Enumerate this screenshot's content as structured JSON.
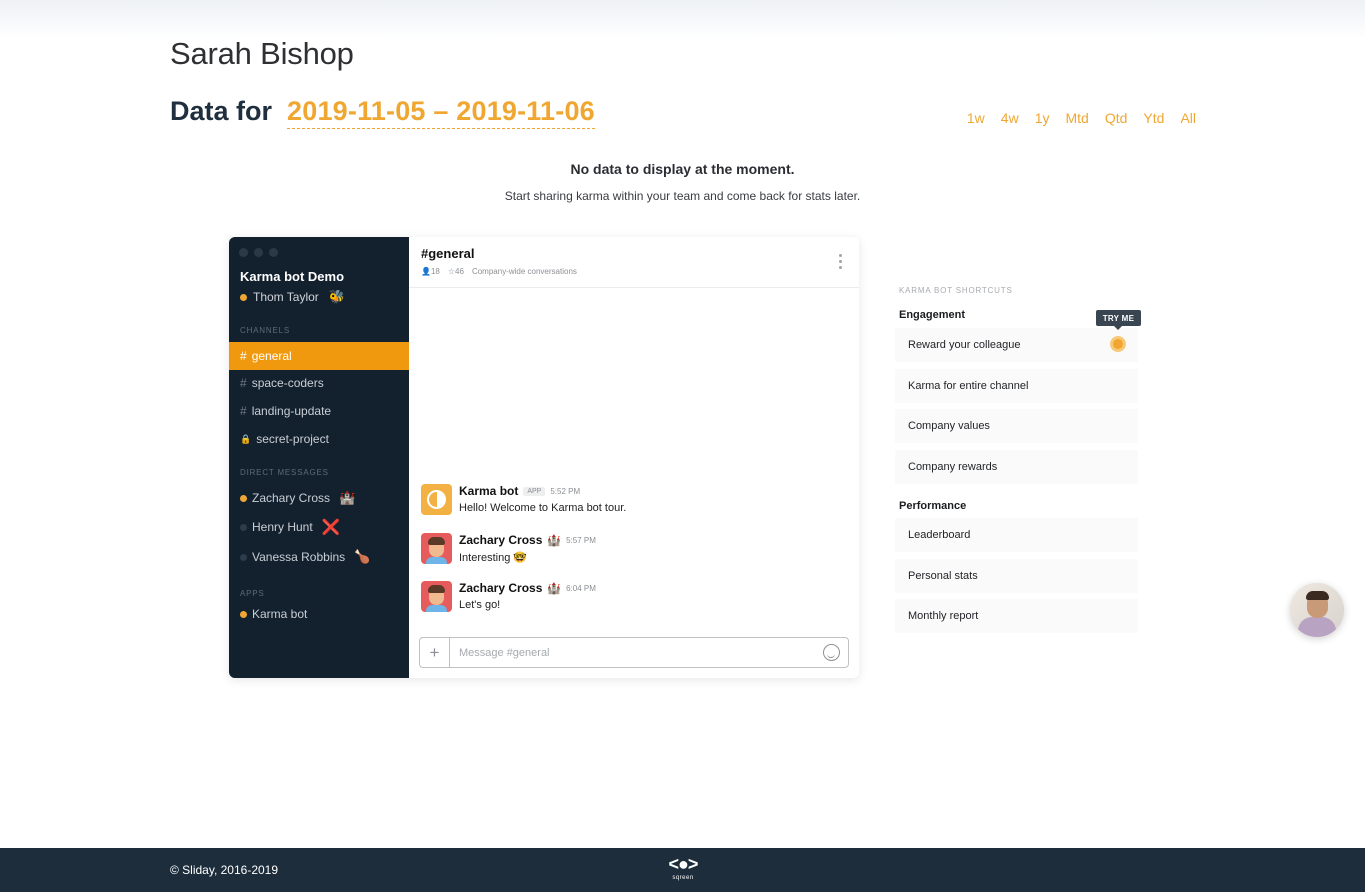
{
  "header": {
    "user_name": "Sarah Bishop",
    "data_for_label": "Data for",
    "date_range": "2019-11-05 – 2019-11-06",
    "periods": [
      "1w",
      "4w",
      "1y",
      "Mtd",
      "Qtd",
      "Ytd",
      "All"
    ]
  },
  "empty_state": {
    "title": "No data to display at the moment.",
    "subtitle": "Start sharing karma within your team and come back for stats later."
  },
  "demo": {
    "workspace": "Karma bot Demo",
    "current_user": "Thom Taylor",
    "current_user_emoji": "🐝",
    "channels_label": "CHANNELS",
    "channels": [
      {
        "name": "general",
        "prefix": "#"
      },
      {
        "name": "space-coders",
        "prefix": "#"
      },
      {
        "name": "landing-update",
        "prefix": "#"
      },
      {
        "name": "secret-project",
        "prefix": "🔒"
      }
    ],
    "dm_label": "DIRECT MESSAGES",
    "dms": [
      {
        "name": "Zachary Cross",
        "emoji": "🏰"
      },
      {
        "name": "Henry Hunt",
        "emoji": "❌"
      },
      {
        "name": "Vanessa Robbins",
        "emoji": "🍗"
      }
    ],
    "apps_label": "APPS",
    "apps": [
      {
        "name": "Karma bot"
      }
    ],
    "channel": {
      "title": "#general",
      "members": "18",
      "pins": "46",
      "description": "Company-wide conversations"
    },
    "messages": [
      {
        "author": "Karma bot",
        "tag": "APP",
        "time": "5:52 PM",
        "text": "Hello! Welcome to Karma bot tour."
      },
      {
        "author": "Zachary Cross",
        "emoji": "🏰",
        "time": "5:57 PM",
        "text": "Interesting 🤓"
      },
      {
        "author": "Zachary Cross",
        "emoji": "🏰",
        "time": "6:04 PM",
        "text": "Let's go!"
      }
    ],
    "composer_placeholder": "Message #general"
  },
  "shortcuts": {
    "label": "KARMA BOT SHORTCUTS",
    "try_me": "TRY ME",
    "groups": [
      {
        "title": "Engagement",
        "items": [
          "Reward your colleague",
          "Karma for entire channel",
          "Company values",
          "Company rewards"
        ]
      },
      {
        "title": "Performance",
        "items": [
          "Leaderboard",
          "Personal stats",
          "Monthly report"
        ]
      }
    ]
  },
  "footer": {
    "copyright": "© Sliday, 2016-2019",
    "logo_text": "sqreen"
  },
  "colors": {
    "accent": "#f0a732",
    "sidebar": "#13212f",
    "footer": "#1d2d3c"
  }
}
